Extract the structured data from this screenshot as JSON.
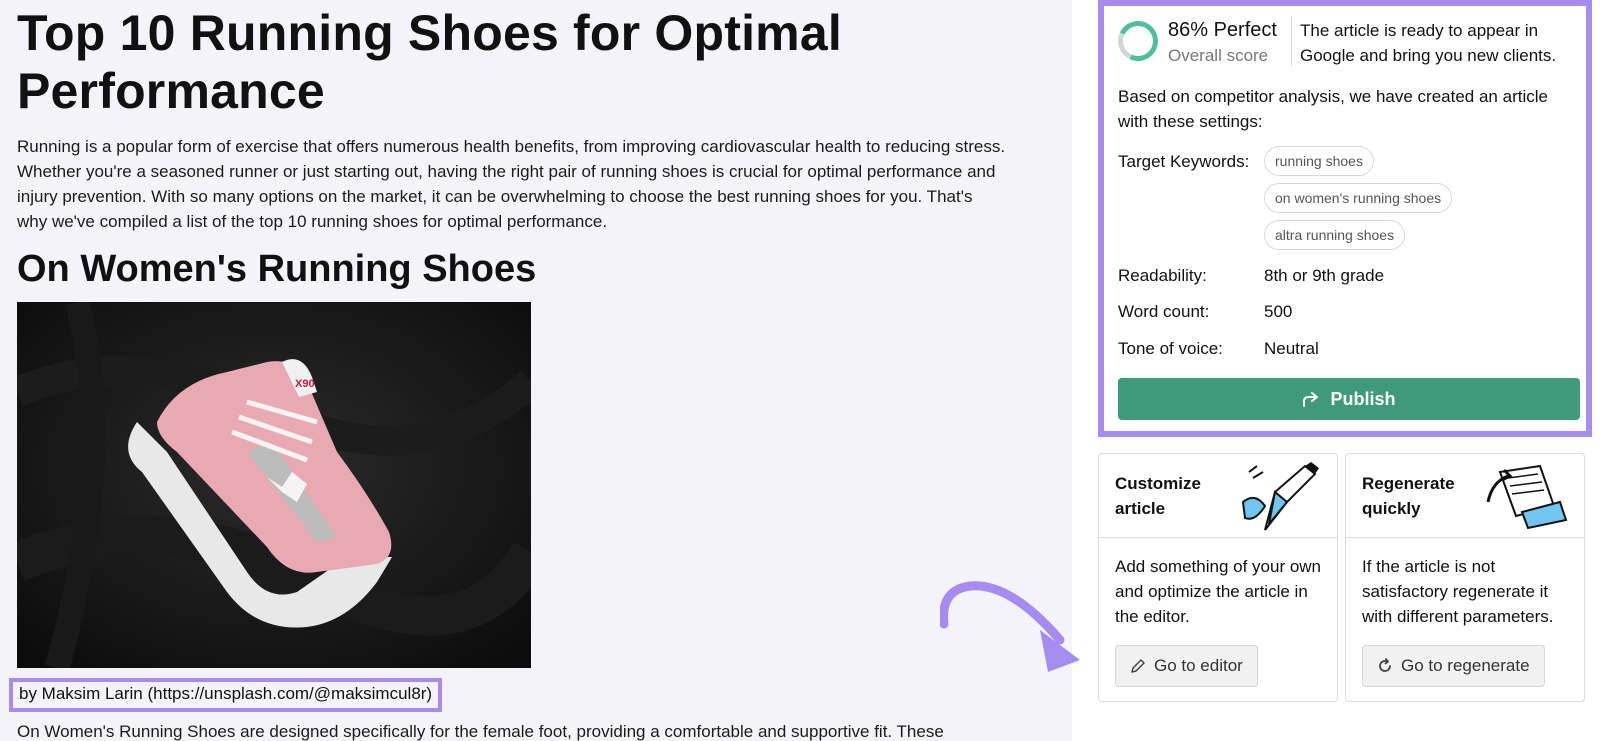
{
  "article": {
    "title": "Top 10 Running Shoes for Optimal Performance",
    "intro": "Running is a popular form of exercise that offers numerous health benefits, from improving cardiovascular health to reducing stress. Whether you're a seasoned runner or just starting out, having the right pair of running shoes is crucial for optimal performance and injury prevention. With so many options on the market, it can be overwhelming to choose the best running shoes for you. That's why we've compiled a list of the top 10 running shoes for optimal performance.",
    "section_heading": "On Women's Running Shoes",
    "photo_credit": "by Maksim Larin (https://unsplash.com/@maksimcul8r)",
    "body_start": "On Women's Running Shoes are designed specifically for the female foot, providing a comfortable and supportive fit. These"
  },
  "score": {
    "title": "86% Perfect",
    "subtitle": "Overall score",
    "value_percent": 86,
    "message": "The article is ready to appear in Google and bring you new clients.",
    "based_on": "Based on competitor analysis, we have created an article with these settings:"
  },
  "settings": {
    "keywords_label": "Target Keywords:",
    "keywords": [
      "running shoes",
      "on women's running shoes",
      "altra running shoes"
    ],
    "readability_label": "Readability:",
    "readability_value": "8th or 9th grade",
    "wordcount_label": "Word count:",
    "wordcount_value": "500",
    "tone_label": "Tone of voice:",
    "tone_value": "Neutral"
  },
  "publish_label": "Publish",
  "cards": [
    {
      "title": "Customize article",
      "description": "Add something of your own and optimize the article in the editor.",
      "button": "Go to editor"
    },
    {
      "title": "Regenerate quickly",
      "description": "If the article is not satisfactory regenerate it with different parameters.",
      "button": "Go to regenerate"
    }
  ],
  "colors": {
    "accent_outline": "#a68bf0",
    "publish_green": "#3f9a7b",
    "ring_green": "#4cbfa0",
    "background": "#f4f3fb"
  }
}
